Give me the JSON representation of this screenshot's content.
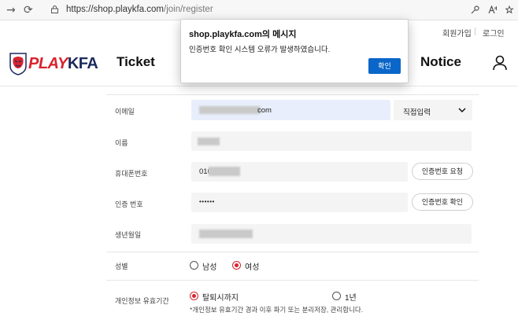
{
  "browser": {
    "url_host": "https://shop.playkfa.com",
    "url_path": "/join/register",
    "back_glyph": "→",
    "reload_glyph": "⟳"
  },
  "header": {
    "util_links": [
      "회원가입",
      "로그인"
    ],
    "logo_play": "PLAY",
    "logo_kfa": "KFA",
    "menu": [
      "Ticket",
      "Notice"
    ]
  },
  "form": {
    "email_label": "이메일",
    "email_suffix": "com",
    "email_domain_select": "직접입력",
    "name_label": "이름",
    "phone_label": "휴대폰번호",
    "phone_prefix": "010",
    "phone_request_button": "인증번호 요청",
    "auth_label": "인증 번호",
    "auth_value": "••••••",
    "auth_confirm_button": "인증번호 확인",
    "birth_label": "생년월일",
    "gender_label": "성별",
    "gender_options": [
      "남성",
      "여성"
    ],
    "gender_selected": "여성",
    "retention_label": "개인정보 유효기간",
    "retention_options": [
      "탈퇴시까지",
      "1년"
    ],
    "retention_selected": "탈퇴시까지",
    "retention_note": "*개인정보 유효기간 경과 이후 파기 또는 분리저장, 관리합니다."
  },
  "dialog": {
    "title": "shop.playkfa.com의 메시지",
    "message": "인증번호 확인 시스템 오류가 발생하였습니다.",
    "ok_button": "확인"
  },
  "colors": {
    "accent": "#d9232e",
    "navy": "#1b2a5e",
    "dialog_button": "#0a66c8"
  }
}
